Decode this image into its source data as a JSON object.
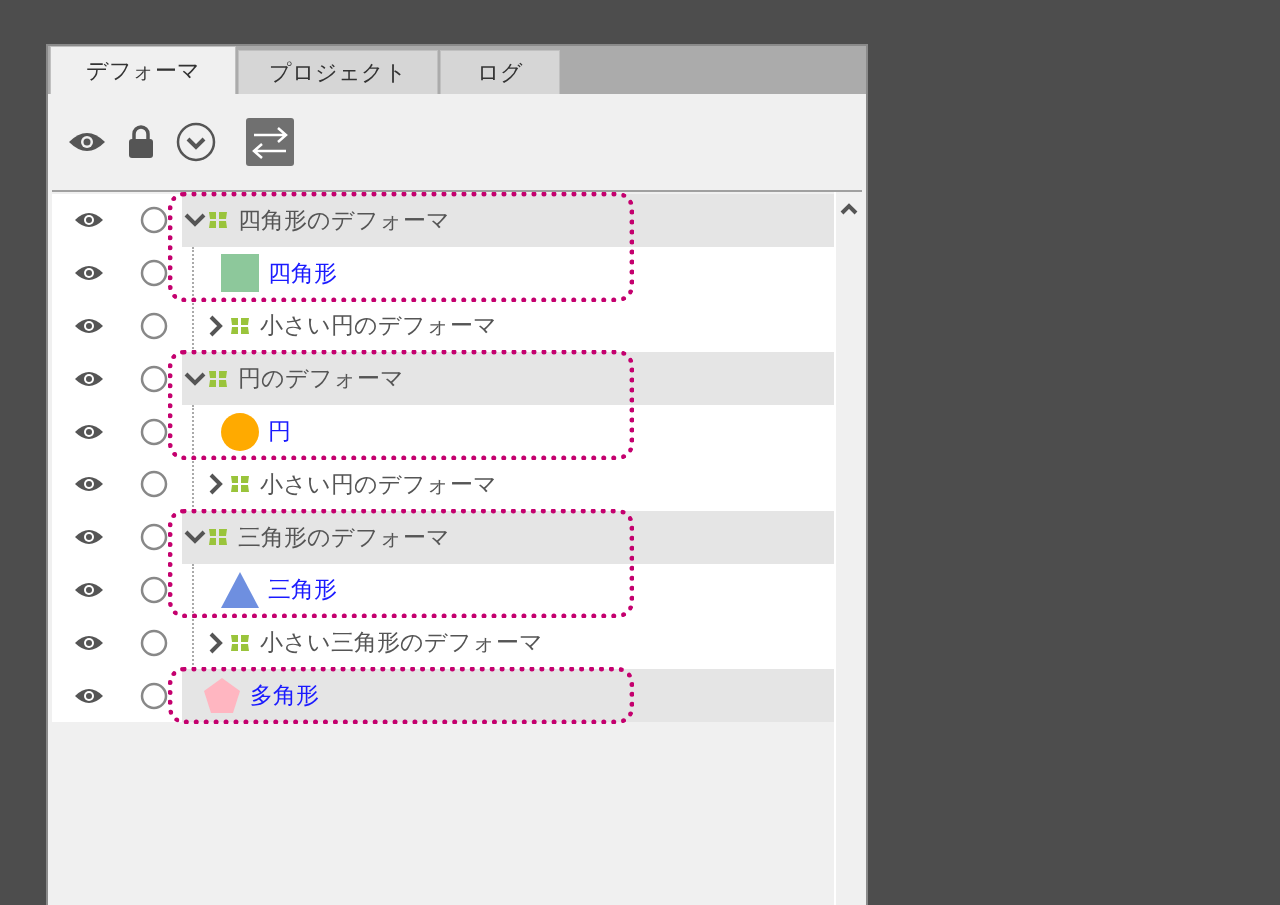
{
  "tabs": [
    {
      "label": "デフォーマ",
      "selected": true
    },
    {
      "label": "プロジェクト",
      "selected": false
    },
    {
      "label": "ログ",
      "selected": false
    }
  ],
  "tree": [
    {
      "kind": "deformer",
      "label": "四角形のデフォーマ",
      "visible": true,
      "highlighted": true,
      "outlined": true,
      "expanded": true,
      "children": [
        {
          "kind": "square",
          "color": "#8dc89b",
          "label": "四角形",
          "visible": true,
          "highlighted": false,
          "outlined": true
        },
        {
          "kind": "deformer",
          "label": "小さい円のデフォーマ",
          "visible": true,
          "highlighted": false,
          "outlined": false,
          "expanded": false
        }
      ]
    },
    {
      "kind": "deformer",
      "label": "円のデフォーマ",
      "visible": true,
      "highlighted": true,
      "outlined": true,
      "expanded": true,
      "children": [
        {
          "kind": "circle",
          "color": "#ffaa00",
          "label": "円",
          "visible": true,
          "highlighted": false,
          "outlined": true
        },
        {
          "kind": "deformer",
          "label": "小さい円のデフォーマ",
          "visible": true,
          "highlighted": false,
          "outlined": false,
          "expanded": false
        }
      ]
    },
    {
      "kind": "deformer",
      "label": "三角形のデフォーマ",
      "visible": true,
      "highlighted": true,
      "outlined": true,
      "expanded": true,
      "children": [
        {
          "kind": "triangle",
          "color": "#6e8fe0",
          "label": "三角形",
          "visible": true,
          "highlighted": false,
          "outlined": true
        },
        {
          "kind": "deformer",
          "label": "小さい三角形のデフォーマ",
          "visible": true,
          "highlighted": false,
          "outlined": false,
          "expanded": false
        }
      ]
    },
    {
      "kind": "pentagon",
      "color": "#ffb6c1",
      "label": "多角形",
      "visible": true,
      "highlighted": true,
      "outlined": true
    }
  ]
}
